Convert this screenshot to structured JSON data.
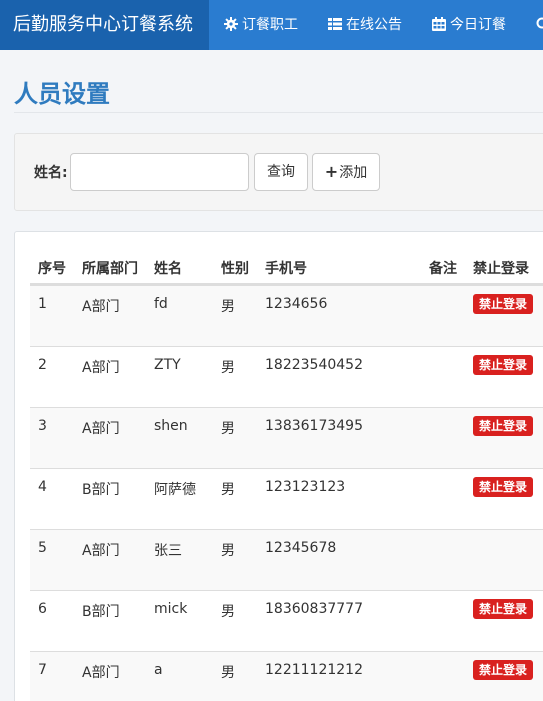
{
  "navbar": {
    "brand": "后勤服务中心订餐系统",
    "items": [
      {
        "label": "订餐职工",
        "icon": "gear-icon"
      },
      {
        "label": "在线公告",
        "icon": "list-icon"
      },
      {
        "label": "今日订餐",
        "icon": "calendar-icon"
      },
      {
        "label": "",
        "icon": "search-icon"
      }
    ]
  },
  "page": {
    "title": "人员设置"
  },
  "search": {
    "label": "姓名:",
    "value": "",
    "query_button": "查询",
    "add_button": "添加"
  },
  "table": {
    "headers": {
      "index": "序号",
      "dept": "所属部门",
      "name": "姓名",
      "gender": "性别",
      "phone": "手机号",
      "note": "备注",
      "ban": "禁止登录"
    },
    "rows": [
      {
        "index": "1",
        "dept": "A部门",
        "name": "fd",
        "gender": "男",
        "phone": "1234656",
        "ban": "禁止登录"
      },
      {
        "index": "2",
        "dept": "A部门",
        "name": "ZTY",
        "gender": "男",
        "phone": "18223540452",
        "ban": "禁止登录"
      },
      {
        "index": "3",
        "dept": "A部门",
        "name": "shen",
        "gender": "男",
        "phone": "13836173495",
        "ban": "禁止登录"
      },
      {
        "index": "4",
        "dept": "B部门",
        "name": "阿萨德",
        "gender": "男",
        "phone": "123123123",
        "ban": "禁止登录"
      },
      {
        "index": "5",
        "dept": "A部门",
        "name": "张三",
        "gender": "男",
        "phone": "12345678",
        "ban": ""
      },
      {
        "index": "6",
        "dept": "B部门",
        "name": "mick",
        "gender": "男",
        "phone": "18360837777",
        "ban": "禁止登录"
      },
      {
        "index": "7",
        "dept": "A部门",
        "name": "a",
        "gender": "男",
        "phone": "12211121212",
        "ban": "禁止登录"
      }
    ]
  },
  "colors": {
    "navbar": "#2a7cd0",
    "brand_bg": "#1a62ad",
    "title": "#2f7bbf",
    "danger": "#d9211f"
  }
}
